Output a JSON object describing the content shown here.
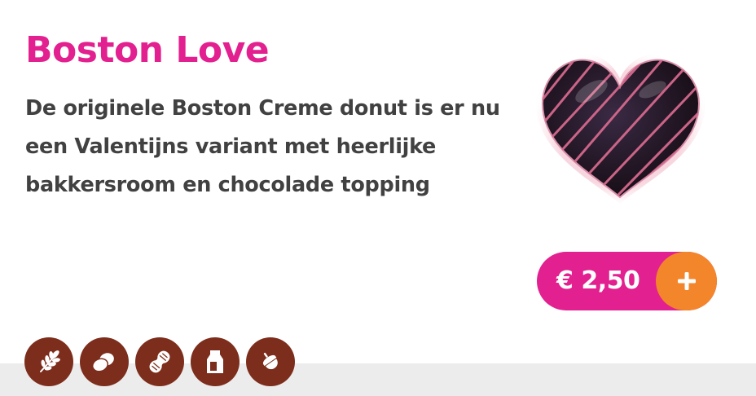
{
  "product": {
    "title": "Boston Love",
    "description": "De originele Boston Creme donut is er nu een Valentijns variant met heerlijke bakkersroom en chocolade topping",
    "price": "€ 2,50",
    "add_label": "+"
  },
  "allergens": [
    {
      "icon": "wheat-icon"
    },
    {
      "icon": "egg-icon"
    },
    {
      "icon": "peanut-icon"
    },
    {
      "icon": "milk-icon"
    },
    {
      "icon": "hazelnut-icon"
    }
  ],
  "colors": {
    "title": "#e2208f",
    "text": "#414141",
    "price_pill": "#e2208f",
    "add_button": "#f3862a",
    "allergen_badge": "#7d2d1c",
    "footer": "#ececec"
  }
}
